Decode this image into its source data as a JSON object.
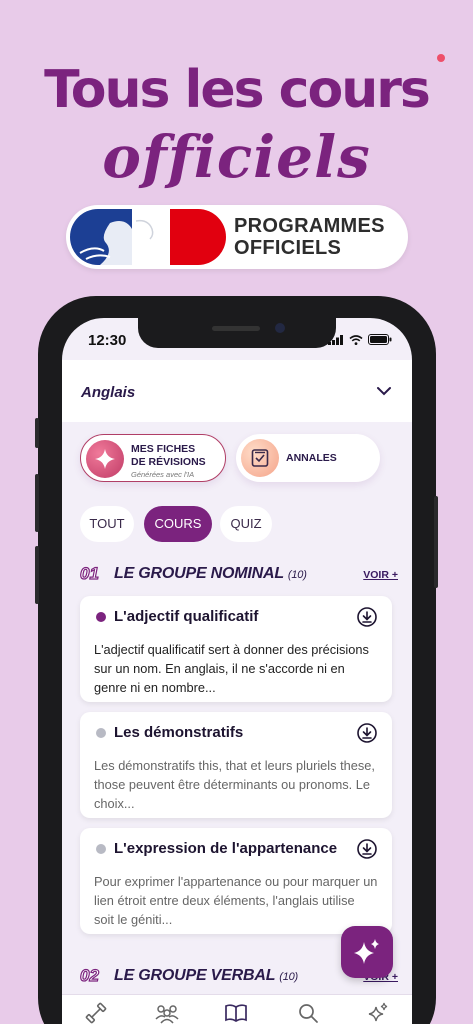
{
  "promo": {
    "headline": "Tous les cours",
    "headline_script": "officiels",
    "badge_line1": "PROGRAMMES",
    "badge_line2": "OFFICIELS"
  },
  "status": {
    "time": "12:30"
  },
  "header": {
    "subject": "Anglais"
  },
  "shortcuts": {
    "fiches_line1": "MES FICHES",
    "fiches_line2": "DE RÉVISIONS",
    "fiches_sub": "Générées avec l'IA",
    "annales": "ANNALES"
  },
  "tabs": [
    {
      "label": "TOUT",
      "active": false
    },
    {
      "label": "COURS",
      "active": true
    },
    {
      "label": "QUIZ",
      "active": false
    }
  ],
  "sections": [
    {
      "number": "01",
      "title": "LE GROUPE NOMINAL",
      "count": "(10)",
      "link": "VOIR +",
      "cards": [
        {
          "title": "L'adjectif qualificatif",
          "body": "L'adjectif qualificatif sert à donner des précisions sur un nom. En anglais, il ne s'accorde ni en genre ni en nombre...",
          "dot_color": "#7b237e"
        },
        {
          "title": "Les démonstratifs",
          "body": "Les démonstratifs this, that et leurs pluriels these, those peuvent être déterminants ou pronoms. Le choix...",
          "dot_color": "#b8bac4"
        },
        {
          "title": "L'expression de l'appartenance",
          "body": "Pour exprimer l'appartenance ou pour marquer un lien étroit entre deux éléments, l'anglais utilise soit le géniti...",
          "dot_color": "#b8bac4"
        }
      ]
    },
    {
      "number": "02",
      "title": "LE GROUPE VERBAL",
      "count": "(10)",
      "link": "VOIR +"
    }
  ],
  "bottom_nav": [
    {
      "icon": "dumbbell-icon"
    },
    {
      "icon": "community-icon"
    },
    {
      "icon": "book-icon",
      "active": true
    },
    {
      "icon": "search-icon"
    },
    {
      "icon": "sparkles-icon"
    }
  ],
  "colors": {
    "brand": "#7b237e",
    "background": "#e8cbe9",
    "accent_pink": "#b03e66"
  }
}
